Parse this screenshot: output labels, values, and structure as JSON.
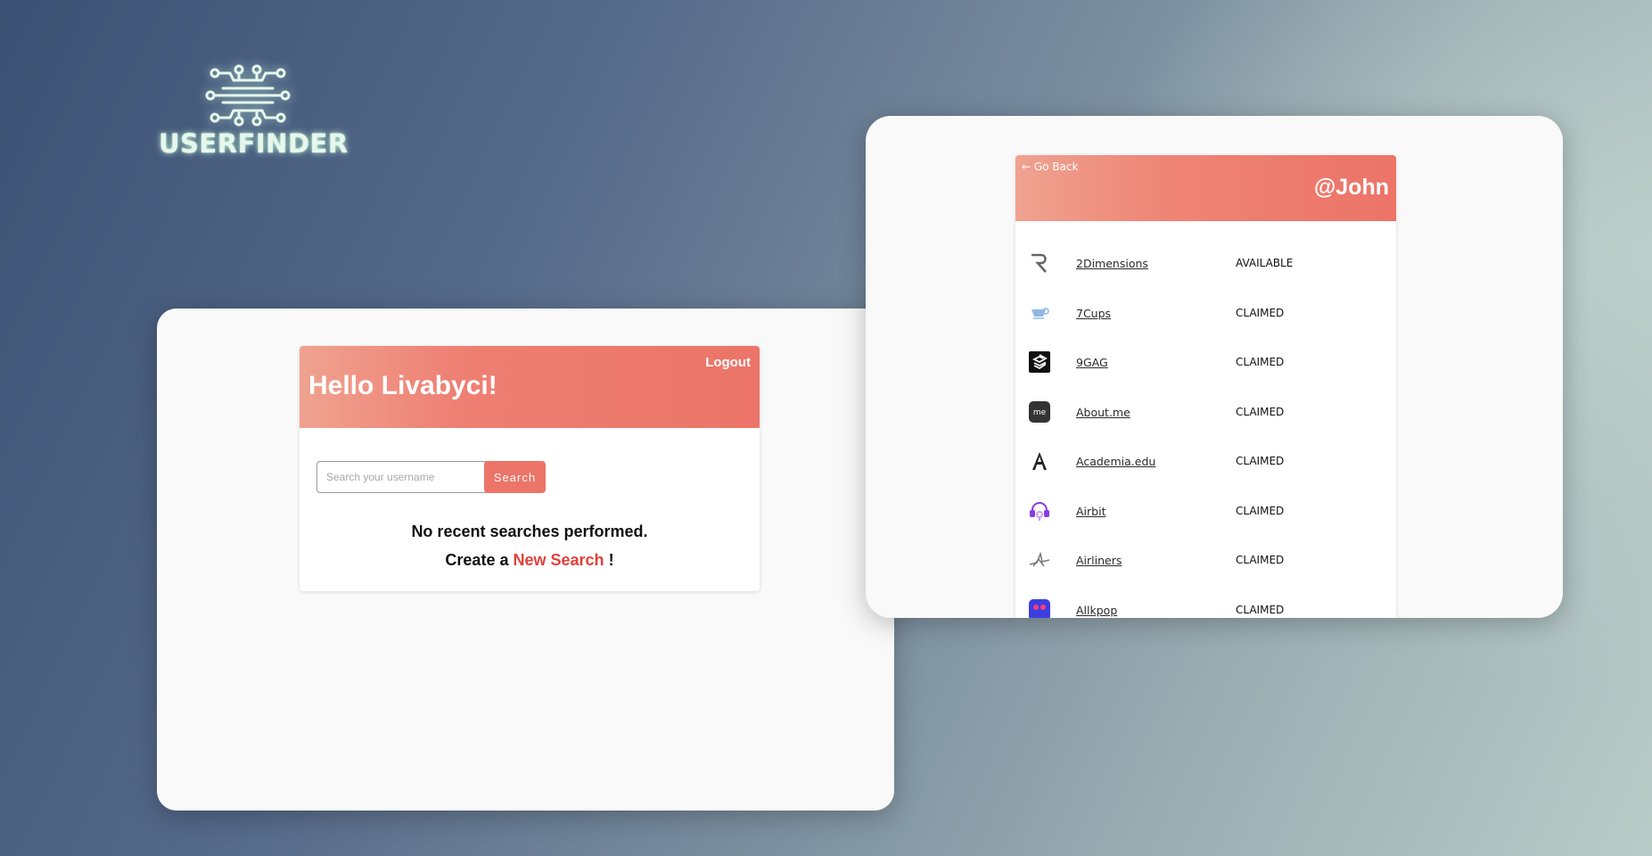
{
  "logo": {
    "text": "USERFINDER",
    "icon": "circuit-icon",
    "color": "#e6f7ec"
  },
  "dashboard": {
    "greeting": "Hello Livabyci!",
    "logout_label": "Logout",
    "search": {
      "placeholder": "Search your username",
      "value": "",
      "button_label": "Search"
    },
    "empty_message": "No recent searches performed.",
    "create_prefix": "Create a",
    "create_link": "New Search",
    "create_suffix": "!",
    "accent_color": "#ec7468",
    "link_color": "#e2403a"
  },
  "results": {
    "back_label": "← Go Back",
    "username": "@John",
    "sites": [
      {
        "name": "2Dimensions",
        "status": "AVAILABLE",
        "icon": "2dimensions-icon"
      },
      {
        "name": "7Cups",
        "status": "CLAIMED",
        "icon": "7cups-icon"
      },
      {
        "name": "9GAG",
        "status": "CLAIMED",
        "icon": "9gag-icon"
      },
      {
        "name": "About.me",
        "status": "CLAIMED",
        "icon": "aboutme-icon"
      },
      {
        "name": "Academia.edu",
        "status": "CLAIMED",
        "icon": "academia-icon"
      },
      {
        "name": "Airbit",
        "status": "CLAIMED",
        "icon": "airbit-icon"
      },
      {
        "name": "Airliners",
        "status": "CLAIMED",
        "icon": "airliners-icon"
      },
      {
        "name": "Allkpop",
        "status": "CLAIMED",
        "icon": "allkpop-icon"
      }
    ]
  }
}
